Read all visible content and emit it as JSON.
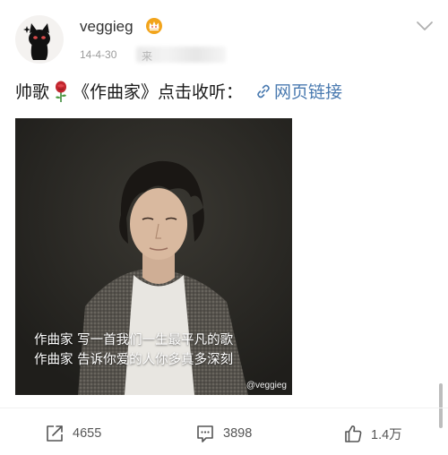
{
  "post": {
    "username": "veggieg",
    "timestamp": "14-4-30",
    "source_partial": "来",
    "text_before": "帅歌",
    "text_after": "《作曲家》点击收听：",
    "link_label": "网页链接"
  },
  "media": {
    "lyric_line_1": "作曲家 写一首我们一生最平凡的歌",
    "lyric_line_2": "作曲家 告诉你爱的人你多真多深刻",
    "watermark": "@veggieg"
  },
  "actions": {
    "repost_count": "4655",
    "comment_count": "3898",
    "like_count": "1.4万"
  },
  "icons": [
    "cat-avatar-icon",
    "crown-icon",
    "chevron-down-icon",
    "rose-icon",
    "link-icon",
    "repost-icon",
    "comment-icon",
    "like-icon"
  ],
  "colors": {
    "link": "#4a7ab0",
    "crown": "#f2a41b",
    "rose": "#c2262e",
    "secondary_text": "#9a9a9a"
  }
}
